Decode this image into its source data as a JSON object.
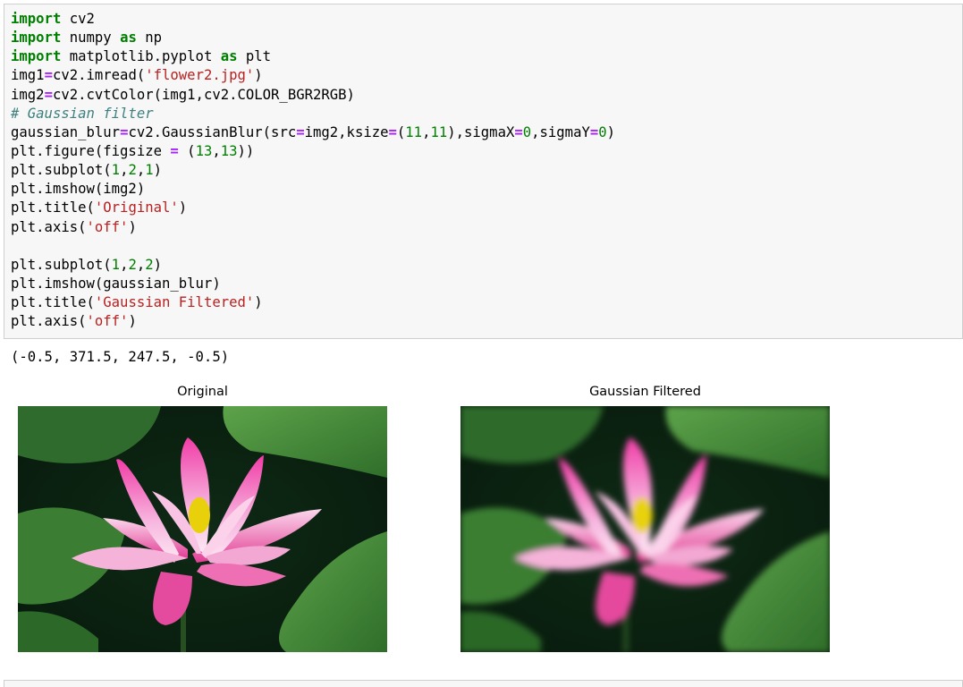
{
  "code_cell": {
    "lines": [
      [
        {
          "t": "import",
          "c": "kw"
        },
        {
          "t": " cv2",
          "c": ""
        }
      ],
      [
        {
          "t": "import",
          "c": "kw"
        },
        {
          "t": " numpy ",
          "c": ""
        },
        {
          "t": "as",
          "c": "kw"
        },
        {
          "t": " np",
          "c": ""
        }
      ],
      [
        {
          "t": "import",
          "c": "kw"
        },
        {
          "t": " matplotlib.pyplot ",
          "c": ""
        },
        {
          "t": "as",
          "c": "kw"
        },
        {
          "t": " plt",
          "c": ""
        }
      ],
      [
        {
          "t": "img1",
          "c": ""
        },
        {
          "t": "=",
          "c": "op"
        },
        {
          "t": "cv2.imread(",
          "c": ""
        },
        {
          "t": "'flower2.jpg'",
          "c": "str"
        },
        {
          "t": ")",
          "c": ""
        }
      ],
      [
        {
          "t": "img2",
          "c": ""
        },
        {
          "t": "=",
          "c": "op"
        },
        {
          "t": "cv2.cvtColor(img1,cv2.COLOR_BGR2RGB)",
          "c": ""
        }
      ],
      [
        {
          "t": "# Gaussian filter",
          "c": "com"
        }
      ],
      [
        {
          "t": "gaussian_blur",
          "c": ""
        },
        {
          "t": "=",
          "c": "op"
        },
        {
          "t": "cv2.GaussianBlur(src",
          "c": ""
        },
        {
          "t": "=",
          "c": "op"
        },
        {
          "t": "img2,ksize",
          "c": ""
        },
        {
          "t": "=",
          "c": "op"
        },
        {
          "t": "(",
          "c": ""
        },
        {
          "t": "11",
          "c": "num"
        },
        {
          "t": ",",
          "c": ""
        },
        {
          "t": "11",
          "c": "num"
        },
        {
          "t": "),sigmaX",
          "c": ""
        },
        {
          "t": "=",
          "c": "op"
        },
        {
          "t": "0",
          "c": "num"
        },
        {
          "t": ",sigmaY",
          "c": ""
        },
        {
          "t": "=",
          "c": "op"
        },
        {
          "t": "0",
          "c": "num"
        },
        {
          "t": ")",
          "c": ""
        }
      ],
      [
        {
          "t": "plt.figure(figsize ",
          "c": ""
        },
        {
          "t": "=",
          "c": "op"
        },
        {
          "t": " (",
          "c": ""
        },
        {
          "t": "13",
          "c": "num"
        },
        {
          "t": ",",
          "c": ""
        },
        {
          "t": "13",
          "c": "num"
        },
        {
          "t": "))",
          "c": ""
        }
      ],
      [
        {
          "t": "plt.subplot(",
          "c": ""
        },
        {
          "t": "1",
          "c": "num"
        },
        {
          "t": ",",
          "c": ""
        },
        {
          "t": "2",
          "c": "num"
        },
        {
          "t": ",",
          "c": ""
        },
        {
          "t": "1",
          "c": "num"
        },
        {
          "t": ")",
          "c": ""
        }
      ],
      [
        {
          "t": "plt.imshow(img2)",
          "c": ""
        }
      ],
      [
        {
          "t": "plt.title(",
          "c": ""
        },
        {
          "t": "'Original'",
          "c": "str"
        },
        {
          "t": ")",
          "c": ""
        }
      ],
      [
        {
          "t": "plt.axis(",
          "c": ""
        },
        {
          "t": "'off'",
          "c": "str"
        },
        {
          "t": ")",
          "c": ""
        }
      ],
      [
        {
          "t": "",
          "c": ""
        }
      ],
      [
        {
          "t": "plt.subplot(",
          "c": ""
        },
        {
          "t": "1",
          "c": "num"
        },
        {
          "t": ",",
          "c": ""
        },
        {
          "t": "2",
          "c": "num"
        },
        {
          "t": ",",
          "c": ""
        },
        {
          "t": "2",
          "c": "num"
        },
        {
          "t": ")",
          "c": ""
        }
      ],
      [
        {
          "t": "plt.imshow(gaussian_blur)",
          "c": ""
        }
      ],
      [
        {
          "t": "plt.title(",
          "c": ""
        },
        {
          "t": "'Gaussian Filtered'",
          "c": "str"
        },
        {
          "t": ")",
          "c": ""
        }
      ],
      [
        {
          "t": "plt.axis(",
          "c": ""
        },
        {
          "t": "'off'",
          "c": "str"
        },
        {
          "t": ")",
          "c": ""
        }
      ]
    ]
  },
  "output": {
    "text": "(-0.5, 371.5, 247.5, -0.5)"
  },
  "figure": {
    "left_title": "Original",
    "right_title": "Gaussian Filtered"
  },
  "colors": {
    "keyword": "#008000",
    "operator": "#aa22ff",
    "string": "#ba2121",
    "number": "#008000",
    "comment": "#408080",
    "cell_bg": "#f7f7f7"
  }
}
